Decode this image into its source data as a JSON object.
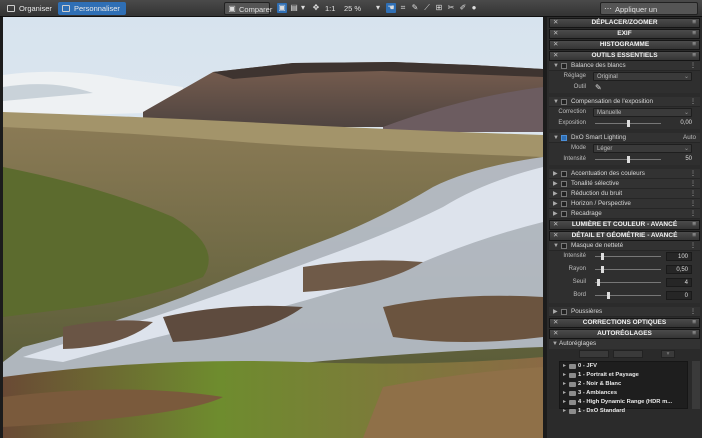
{
  "top": {
    "tabs": [
      {
        "label": "Organiser",
        "active": false
      },
      {
        "label": "Personnaliser",
        "active": true
      }
    ],
    "compare_label": "Comparer",
    "ratio_label": "1:1",
    "zoom": "25 %",
    "auto_label": "Appliquer un autoréglage"
  },
  "panel": {
    "deplacer": "DÉPLACER/ZOOMER",
    "exif": "EXIF",
    "histogramme": "HISTOGRAMME",
    "outils": "OUTILS ESSENTIELS",
    "balance": {
      "title": "Balance des blancs",
      "reglage_label": "Réglage",
      "reglage_value": "Original",
      "outil_label": "Outil"
    },
    "compensation": {
      "title": "Compensation de l'exposition",
      "correction_label": "Correction",
      "correction_value": "Manuelle",
      "exposition_label": "Exposition",
      "exposition_value": "0,00",
      "exposition_level": 0.5
    },
    "smart": {
      "title": "DxO Smart Lighting",
      "mode_right": "Auto",
      "mode_label": "Mode",
      "mode_value": "Léger",
      "intensite_label": "Intensité",
      "intensite_value": "50",
      "intensite_level": 0.5
    },
    "tools": [
      "Accentuation des couleurs",
      "Tonalité sélective",
      "Réduction du bruit",
      "Horizon / Perspective",
      "Recadrage"
    ],
    "lumiere": "LUMIÈRE ET COULEUR - AVANCÉ",
    "detail": "DÉTAIL ET GÉOMÉTRIE - AVANCÉ",
    "masque": {
      "title": "Masque de netteté",
      "rows": [
        {
          "label": "Intensité",
          "value": "100",
          "level": 0.1
        },
        {
          "label": "Rayon",
          "value": "0,50",
          "level": 0.1
        },
        {
          "label": "Seuil",
          "value": "4",
          "level": 0.05
        },
        {
          "label": "Bord",
          "value": "0",
          "level": 0.2
        }
      ]
    },
    "poussieres": "Poussières",
    "corrections": "CORRECTIONS OPTIQUES",
    "autoreglages": "AUTORÉGLAGES",
    "autoreglages_sub": "Autoréglages",
    "presets": [
      "0 - JFV",
      "1 - Portrait et Paysage",
      "2 - Noir & Blanc",
      "3 - Ambiances",
      "4 - High Dynamic Range (HDR m...",
      "1 - DxO Standard"
    ]
  },
  "colors": {
    "accent": "#2f6fb5"
  },
  "icons": [
    "organiser-icon",
    "personnaliser-icon",
    "compare-icon",
    "hand-icon",
    "eyedropper-icon",
    "ellipsis-icon",
    "close-icon",
    "menu-icon"
  ]
}
